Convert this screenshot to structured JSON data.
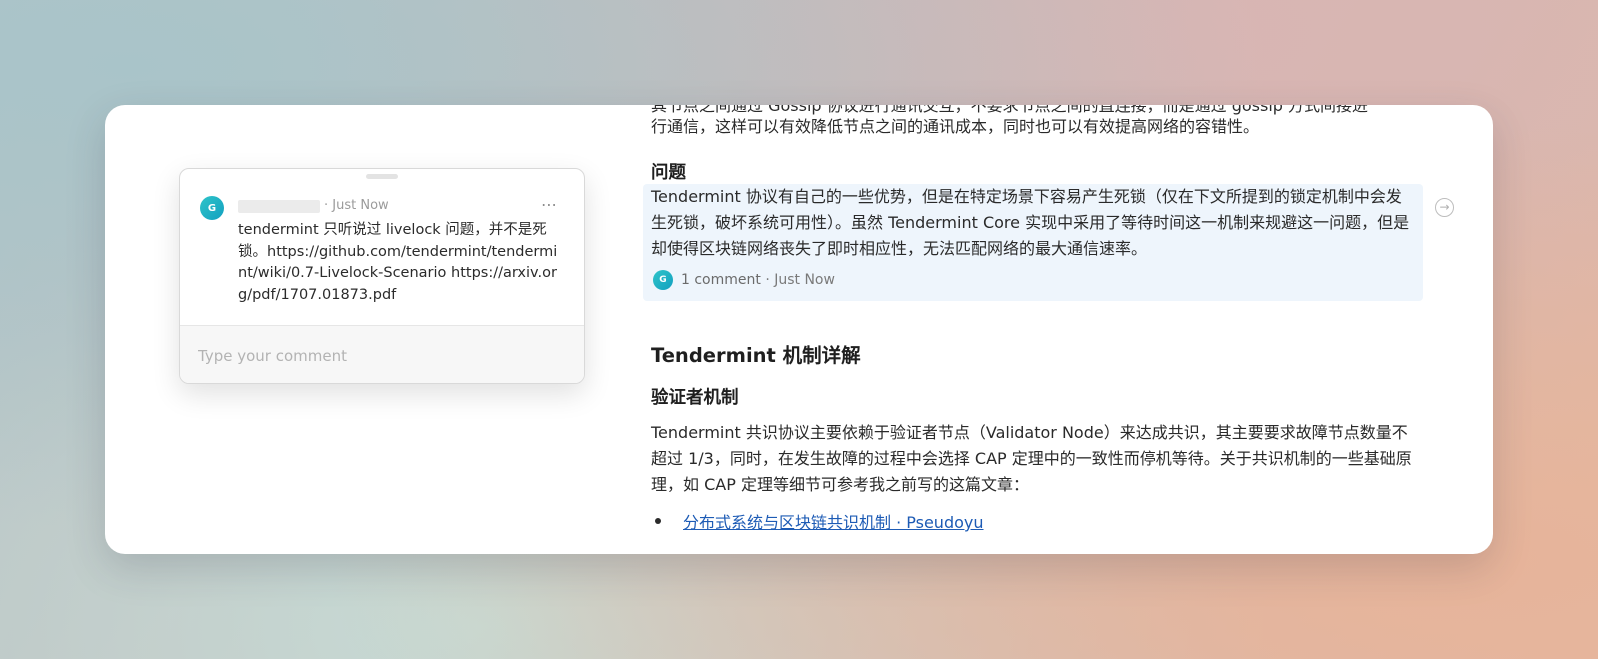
{
  "popover": {
    "avatar_initial": "G",
    "time": "· Just Now",
    "more_icon": "⋯",
    "comment_text": "tendermint 只听说过 livelock 问题，并不是死锁。https://github.com/tendermint/tendermint/wiki/0.7-Livelock-Scenario https://arxiv.org/pdf/1707.01873.pdf",
    "input_placeholder": "Type your comment"
  },
  "doc": {
    "cut_line": "其节点之间通过 Gossip 协议进行通讯交互，不要求节点之间的直连接，而是通过 gossip 方式间接进",
    "intro_tail": "行通信，这样可以有效降低节点之间的通讯成本，同时也可以有效提高网络的容错性。",
    "problem_heading": "问题",
    "problem_text": "Tendermint 协议有自己的一些优势，但是在特定场景下容易产生死锁（仅在下文所提到的锁定机制中会发生死锁，破坏系统可用性）。虽然 Tendermint Core 实现中采用了等待时间这一机制来规避这一问题，但是却使得区块链网络丧失了即时相应性，无法匹配网络的最大通信速率。",
    "comment_count": "1 comment",
    "comment_time": "· Just Now",
    "arrow_icon": "→",
    "mechanism_heading": "Tendermint 机制详解",
    "validator_heading": "验证者机制",
    "validator_text": "Tendermint 共识协议主要依赖于验证者节点（Validator Node）来达成共识，其主要要求故障节点数量不超过 1/3，同时，在发生故障的过程中会选择 CAP 定理中的一致性而停机等待。关于共识机制的一些基础原理，如 CAP 定理等细节可参考我之前写的这篇文章：",
    "link_text": "分布式系统与区块链共识机制 · Pseudoyu"
  }
}
